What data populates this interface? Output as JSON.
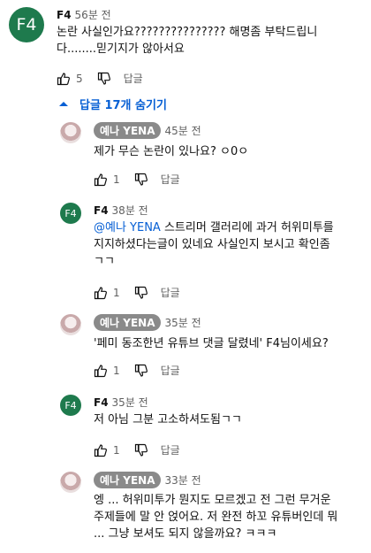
{
  "top": {
    "avatar": "F4",
    "author": "F4",
    "time": "56분 전",
    "text_line1": "논란 사실인가요??????????????? 해명좀 부탁드립니",
    "text_line2": "다........믿기지가 않아서요",
    "likes": "5",
    "reply": "답글"
  },
  "toggle_label": "답글 17개 숨기기",
  "replies": [
    {
      "author": "예나 YENA",
      "time": "45분 전",
      "lines": [
        "제가 무슨 논란이 있나요? ㅇ0ㅇ"
      ],
      "likes": "1",
      "reply": "답글"
    },
    {
      "author": "F4",
      "avatar": "F4",
      "time": "38분 전",
      "mention": "@예나 YENA",
      "first_rest": " 스트리머 갤러리에 과거 허위미투를",
      "lines": [
        "지지하셨다는글이 있네요 사실인지 보시고 확인좀",
        "ㄱㄱ"
      ],
      "likes": "1",
      "reply": "답글"
    },
    {
      "author": "예나 YENA",
      "time": "35분 전",
      "lines": [
        "'페미 동조한년 유튜브 댓글 달렸네' F4님이세요?"
      ],
      "likes": "1",
      "reply": "답글"
    },
    {
      "author": "F4",
      "avatar": "F4",
      "time": "35분 전",
      "lines": [
        "저 아님 그분 고소하셔도됨ㄱㄱ"
      ],
      "likes": "1",
      "reply": "답글"
    },
    {
      "author": "예나 YENA",
      "time": "33분 전",
      "lines": [
        "엥 ... 허위미투가 뭔지도 모르겠고 전 그런 무거운",
        "주제들에 말 안 얹어요. 저 완전 하꼬 유튜버인데 뭐",
        "... 그냥 보셔도 되지 않을까요? ㅋㅋㅋ"
      ]
    }
  ],
  "colors": {
    "accent": "#065fd4",
    "avatar_green": "#1e7a4d",
    "pill": "#8a8a8a"
  }
}
